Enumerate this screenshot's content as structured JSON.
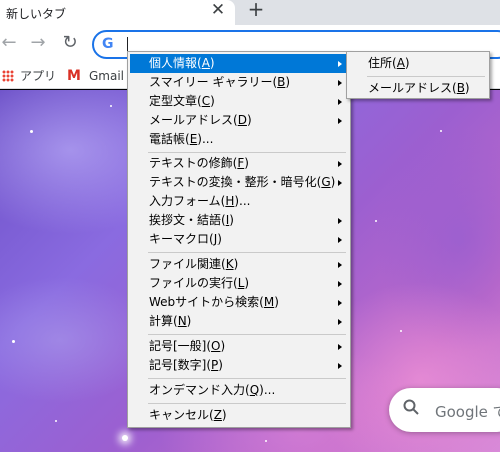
{
  "browser": {
    "tab_title": "新しいタブ",
    "tab_close_glyph": "✕",
    "new_tab_glyph": "+",
    "back_glyph": "←",
    "forward_glyph": "→",
    "reload_glyph": "↻",
    "google_glyph": "G",
    "bookmarks": [
      {
        "label": "アプリ",
        "icon": "apps-grid-icon"
      },
      {
        "label": "Gmail",
        "icon": "gmail-icon",
        "icon_glyph": "M"
      }
    ]
  },
  "page": {
    "search_placeholder": "Google で"
  },
  "menu": {
    "items": [
      {
        "label": "個人情報(",
        "key": "A",
        "tail": ")",
        "submenu": true,
        "active": true
      },
      {
        "label": "スマイリー ギャラリー(",
        "key": "B",
        "tail": ")",
        "submenu": true
      },
      {
        "label": "定型文章(",
        "key": "C",
        "tail": ")",
        "submenu": true
      },
      {
        "label": "メールアドレス(",
        "key": "D",
        "tail": ")",
        "submenu": true
      },
      {
        "label": "電話帳(",
        "key": "E",
        "tail": ")...",
        "submenu": false
      },
      {
        "label": "テキストの修飾(",
        "key": "F",
        "tail": ")",
        "submenu": true
      },
      {
        "label": "テキストの変換・整形・暗号化(",
        "key": "G",
        "tail": ")",
        "submenu": true
      },
      {
        "label": "入力フォーム(",
        "key": "H",
        "tail": ")...",
        "submenu": false
      },
      {
        "label": "挨拶文・結語(",
        "key": "I",
        "tail": ")",
        "submenu": true
      },
      {
        "label": "キーマクロ(",
        "key": "J",
        "tail": ")",
        "submenu": true
      },
      {
        "label": "ファイル関連(",
        "key": "K",
        "tail": ")",
        "submenu": true
      },
      {
        "label": "ファイルの実行(",
        "key": "L",
        "tail": ")",
        "submenu": true
      },
      {
        "label": "Webサイトから検索(",
        "key": "M",
        "tail": ")",
        "submenu": true
      },
      {
        "label": "計算(",
        "key": "N",
        "tail": ")",
        "submenu": true
      },
      {
        "label": "記号[一般](",
        "key": "O",
        "tail": ")",
        "submenu": true
      },
      {
        "label": "記号[数字](",
        "key": "P",
        "tail": ")",
        "submenu": true
      },
      {
        "label": "オンデマンド入力(",
        "key": "Q",
        "tail": ")...",
        "submenu": false
      },
      {
        "label": "キャンセル(",
        "key": "Z",
        "tail": ")",
        "submenu": false
      }
    ],
    "submenu_items": [
      {
        "label": "住所(",
        "key": "A",
        "tail": ")"
      },
      {
        "label": "メールアドレス(",
        "key": "B",
        "tail": ")"
      }
    ]
  },
  "colors": {
    "menu_highlight": "#0078d7",
    "menu_background": "#f2f2f2",
    "omnibox_focus": "#1a73e8"
  }
}
